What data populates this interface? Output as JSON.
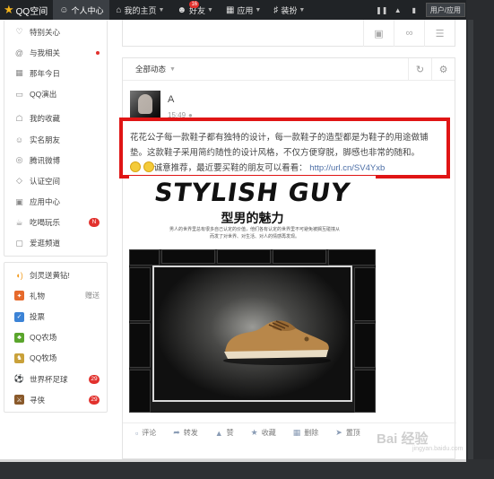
{
  "topbar": {
    "logo": "QQ空间",
    "nav": [
      {
        "label": "个人中心",
        "icon": "person-icon"
      },
      {
        "label": "我的主页",
        "icon": "home-icon"
      },
      {
        "label": "好友",
        "icon": "friends-icon",
        "badge": "16"
      },
      {
        "label": "应用",
        "icon": "apps-grid-icon"
      },
      {
        "label": "装扮",
        "icon": "shirt-icon"
      }
    ],
    "user_center": "用户/应用"
  },
  "sidebar": {
    "group1": [
      {
        "label": "特别关心",
        "icon": "heart-icon"
      },
      {
        "label": "与我相关",
        "icon": "at-icon",
        "dot": true
      },
      {
        "label": "那年今日",
        "icon": "calendar-icon"
      },
      {
        "label": "QQ演出",
        "icon": "ticket-icon"
      },
      {
        "label": "我的收藏",
        "icon": "bookmark-icon"
      },
      {
        "label": "实名朋友",
        "icon": "id-card-icon"
      },
      {
        "label": "腾讯微博",
        "icon": "weibo-icon"
      },
      {
        "label": "认证空间",
        "icon": "verified-icon"
      },
      {
        "label": "应用中心",
        "icon": "app-center-icon"
      },
      {
        "label": "吃喝玩乐",
        "icon": "food-icon",
        "badge": "N"
      },
      {
        "label": "爱逛频道",
        "icon": "shopping-icon"
      }
    ],
    "group2": [
      {
        "label": "剑灵送黄钻!",
        "icon": "sound-icon"
      },
      {
        "label": "礼物",
        "icon": "gift-icon",
        "extra": "赠送"
      },
      {
        "label": "投票",
        "icon": "vote-icon"
      },
      {
        "label": "QQ农场",
        "icon": "farm-icon"
      },
      {
        "label": "QQ牧场",
        "icon": "ranch-icon"
      },
      {
        "label": "世界杯足球",
        "icon": "football-icon",
        "badge": "29"
      },
      {
        "label": "寻侠",
        "icon": "game-icon",
        "badge": "29"
      }
    ]
  },
  "feed": {
    "header": "全部动态",
    "post": {
      "author": "A",
      "time": "15:49",
      "text_part1": "花花公子每一款鞋子都有独特的设计，每一款鞋子的造型都是为鞋子的用途做铺垫。这款鞋子采用简约随性的设计风格，不仅方便穿脱，脚感也非常的随和。",
      "text_part2": "诚意推荐，最近要买鞋的朋友可以看看：",
      "link": "http://url.cn/SV4Yxb"
    },
    "ad": {
      "title": "STYLISH GUY",
      "subtitle": "型男的魅力",
      "desc": "男人的世界里总有很多自己认定的价值，他们各有认定的世界里不可避免被搁互碰撞从而发了对世界、对生活、对人的情感再发现。"
    },
    "actions": [
      {
        "label": "评论",
        "icon": "comment-icon"
      },
      {
        "label": "转发",
        "icon": "share-icon"
      },
      {
        "label": "赞",
        "icon": "thumbs-up-icon"
      },
      {
        "label": "收藏",
        "icon": "star-icon"
      },
      {
        "label": "删除",
        "icon": "trash-icon"
      },
      {
        "label": "置顶",
        "icon": "pin-icon"
      }
    ]
  },
  "watermark": {
    "brand": "Bai 经验",
    "url": "jingyan.baidu.com"
  },
  "colors": {
    "topbar": "#202326",
    "highlight": "#e01515",
    "link": "#4c6ea6",
    "badge": "#e2312d"
  }
}
